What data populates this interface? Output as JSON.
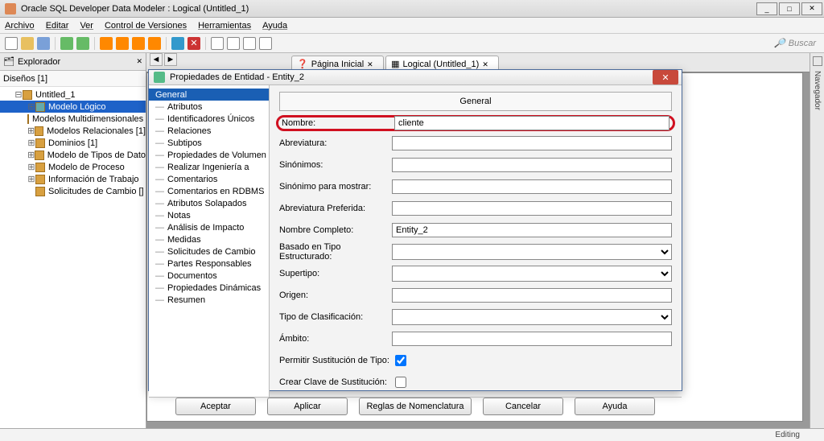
{
  "window": {
    "title": "Oracle SQL Developer Data Modeler : Logical (Untitled_1)"
  },
  "menu": {
    "items": [
      "Archivo",
      "Editar",
      "Ver",
      "Control de Versiones",
      "Herramientas",
      "Ayuda"
    ]
  },
  "search": {
    "placeholder": "Buscar"
  },
  "explorer": {
    "tab": "Explorador",
    "designs": "Diseños [1]",
    "root": "Untitled_1",
    "items": [
      "Modelo Lógico",
      "Modelos Multidimensionales []",
      "Modelos Relacionales [1]",
      "Dominios [1]",
      "Modelo de Tipos de Dato",
      "Modelo de Proceso",
      "Información de Trabajo",
      "Solicitudes de Cambio []"
    ]
  },
  "tabs": {
    "t1": "Página Inicial",
    "t2": "Logical (Untitled_1)"
  },
  "right": {
    "nav": "Navegador"
  },
  "status": {
    "editing": "Editing"
  },
  "dialog": {
    "title": "Propiedades de Entidad - Entity_2",
    "nav": [
      "General",
      "Atributos",
      "Identificadores Únicos",
      "Relaciones",
      "Subtipos",
      "Propiedades de Volumen",
      "Realizar Ingeniería a",
      "Comentarios",
      "Comentarios en RDBMS",
      "Atributos Solapados",
      "Notas",
      "Análisis de Impacto",
      "Medidas",
      "Solicitudes de Cambio",
      "Partes Responsables",
      "Documentos",
      "Propiedades Dinámicas",
      "Resumen"
    ],
    "section": "General",
    "labels": {
      "nombre": "Nombre:",
      "abrev": "Abreviatura:",
      "sinon": "Sinónimos:",
      "sinonm": "Sinónimo para mostrar:",
      "abrevp": "Abreviatura Preferida:",
      "nomc": "Nombre Completo:",
      "basado": "Basado en Tipo Estructurado:",
      "super": "Supertipo:",
      "origen": "Origen:",
      "tipoc": "Tipo de Clasificación:",
      "ambito": "Ámbito:",
      "permit": "Permitir Sustitución de Tipo:",
      "crear": "Crear Clave de Sustitución:"
    },
    "values": {
      "nombre": "cliente",
      "nomc": "Entity_2",
      "permit": true,
      "crear": false
    },
    "buttons": {
      "aceptar": "Aceptar",
      "aplicar": "Aplicar",
      "reglas": "Reglas de Nomenclatura",
      "cancelar": "Cancelar",
      "ayuda": "Ayuda"
    }
  }
}
